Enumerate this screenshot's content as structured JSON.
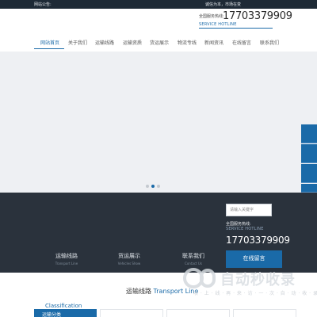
{
  "topbar": {
    "notice": "网站公告:",
    "welcome": "诚信为本，市场在变",
    "link": ""
  },
  "header": {
    "hotline_label": "全国服务热线:",
    "phone": "17703379909",
    "hotline_en": "SERVICE HOTLINE"
  },
  "nav": {
    "items": [
      {
        "label": "网站首页",
        "active": true
      },
      {
        "label": "关于我们",
        "active": false
      },
      {
        "label": "运输线路",
        "active": false
      },
      {
        "label": "运输资质",
        "active": false
      },
      {
        "label": "货运展示",
        "active": false
      },
      {
        "label": "物流专线",
        "active": false
      },
      {
        "label": "新闻资讯",
        "active": false
      },
      {
        "label": "在线留言",
        "active": false
      },
      {
        "label": "联系我们",
        "active": false
      }
    ]
  },
  "banner": {
    "slides": 3,
    "active_slide": 1
  },
  "sidebar": {
    "count": 4
  },
  "footer_dark": {
    "search_placeholder": "请输入关键字",
    "hotline_label": "全国服务热线:",
    "hotline_en": "SERVICE HOTLINE",
    "phone": "17703379909",
    "message_button": "在线留言",
    "links": [
      {
        "cn": "运输线路",
        "en": "Transport Line"
      },
      {
        "cn": "货运展示",
        "en": "Vehicles Show"
      },
      {
        "cn": "联系我们",
        "en": "Contact Us"
      }
    ]
  },
  "section": {
    "title_cn": "运输线路",
    "title_en": "Transport Line",
    "classification": "Classification",
    "tab_label": "运输分类"
  },
  "watermark": {
    "title": "自动秒收录",
    "subtitle": "收 · 上 · 线 · 再 · 来 · 访 · 一 · 次 · 自 · 动 · 收 · 录"
  }
}
